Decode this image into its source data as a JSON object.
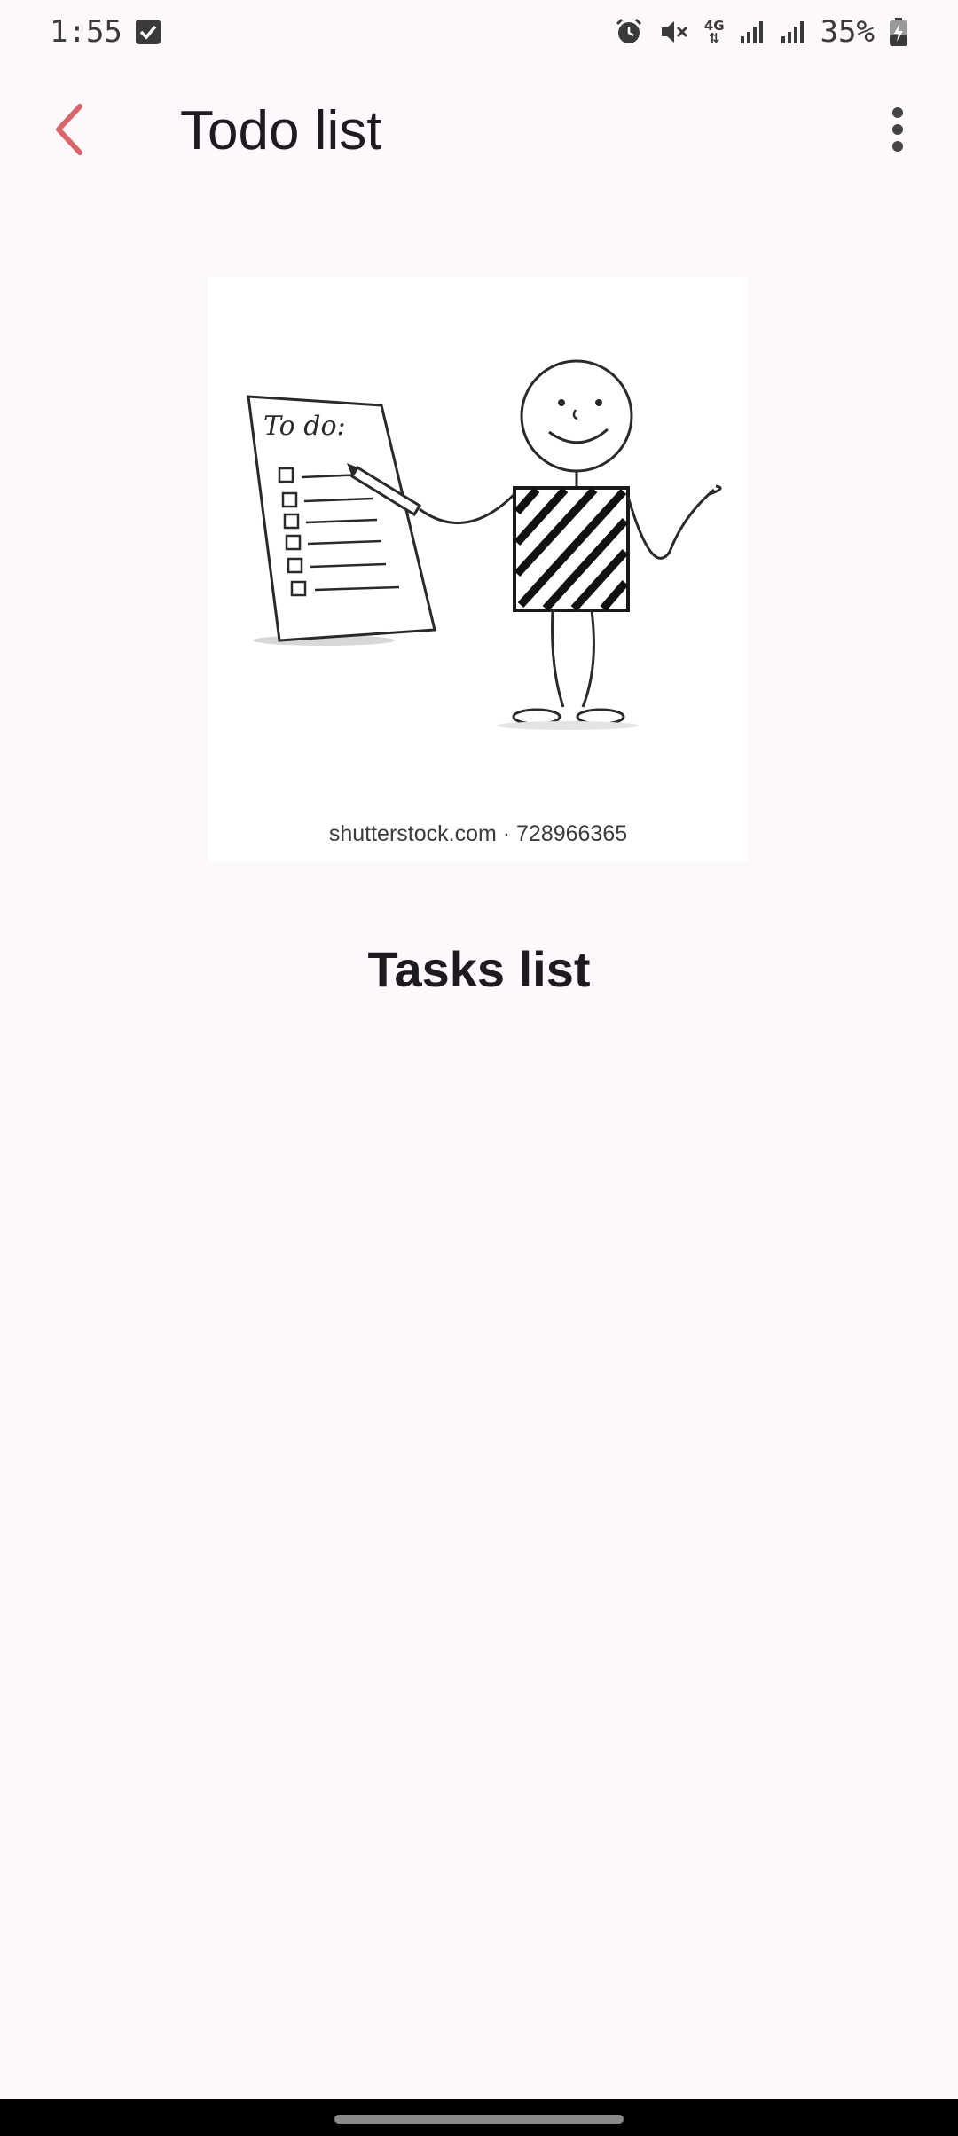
{
  "status_bar": {
    "time": "1:55",
    "battery": "35%",
    "network": "4G",
    "icons": [
      "checkbox-notification-icon",
      "alarm-icon",
      "mute-icon",
      "4g-data-icon",
      "signal-icon",
      "signal-icon",
      "battery-charging-icon"
    ]
  },
  "app_bar": {
    "title": "Todo list",
    "back_icon": "back-arrow-icon",
    "menu_icon": "more-vert-icon",
    "accent_color": "#d9666a"
  },
  "illustration": {
    "paper_heading": "To do:",
    "watermark": "shutterstock.com · 728966365"
  },
  "content": {
    "section_title": "Tasks list"
  },
  "navigation_bar": {
    "home_indicator": "home-handle"
  }
}
